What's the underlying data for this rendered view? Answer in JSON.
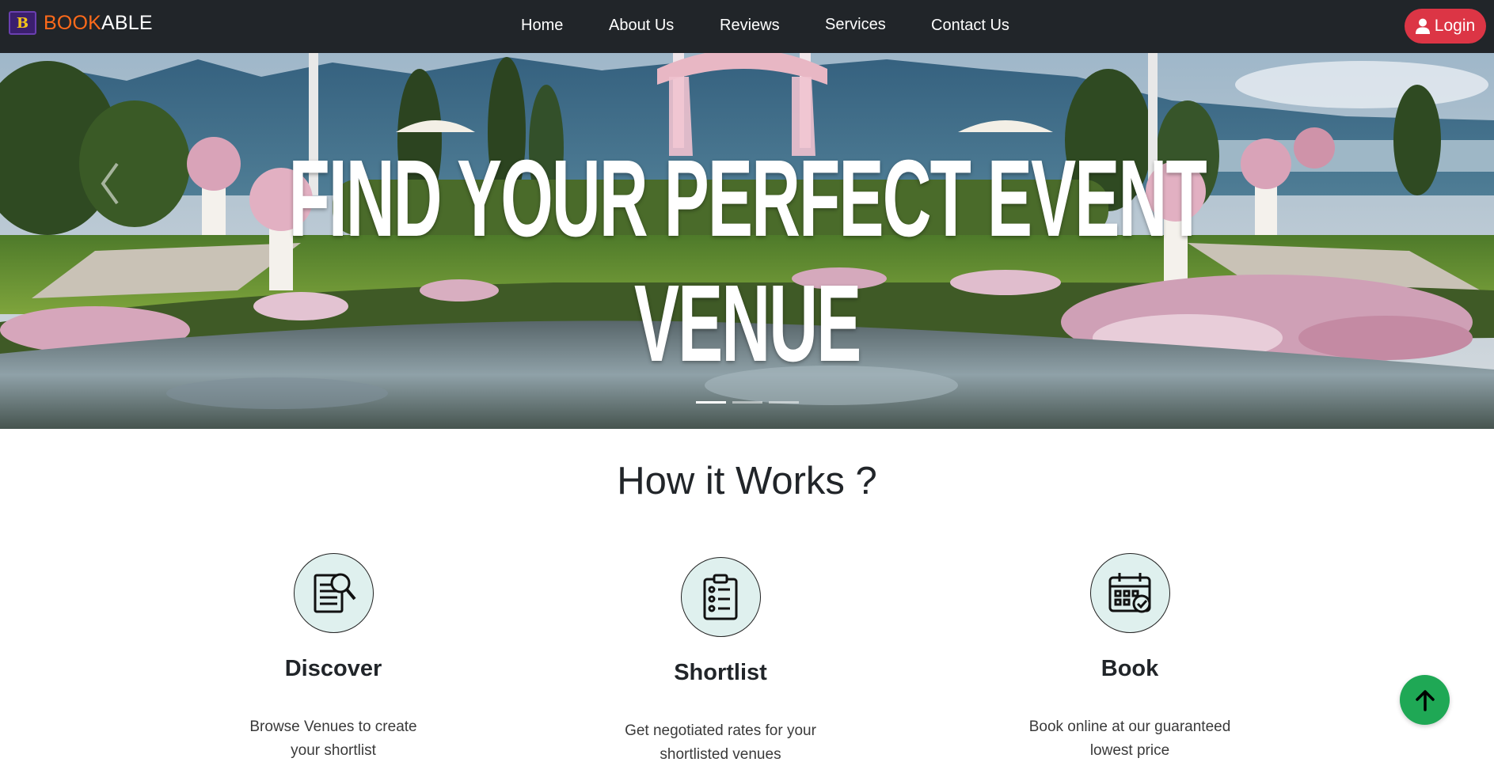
{
  "brand": {
    "book": "BOOK",
    "able": "ABLE",
    "logo_letter": "B"
  },
  "nav": {
    "items": [
      {
        "label": "Home"
      },
      {
        "label": "About Us"
      },
      {
        "label": "Reviews"
      },
      {
        "label": "Services"
      },
      {
        "label": "Contact Us"
      }
    ],
    "login_label": "Login"
  },
  "hero": {
    "title_line1": "FIND YOUR PERFECT EVENT",
    "title_line2": "VENUE",
    "slides": 3,
    "active_slide": 1
  },
  "how_it_works": {
    "title": "How it Works ?",
    "steps": [
      {
        "icon": "document-search-icon",
        "title": "Discover",
        "desc_line1": "Browse Venues to create",
        "desc_line2": "your shortlist"
      },
      {
        "icon": "clipboard-checklist-icon",
        "title": "Shortlist",
        "desc_line1": "Get negotiated rates for your",
        "desc_line2": "shortlisted venues"
      },
      {
        "icon": "calendar-check-icon",
        "title": "Book",
        "desc_line1": "Book online at our guaranteed",
        "desc_line2": "lowest price"
      }
    ]
  },
  "colors": {
    "navbar": "#212529",
    "brand_accent": "#ff6a1a",
    "login_button": "#dc3545",
    "scroll_top_button": "#1fa855",
    "icon_circle": "#dff0ee"
  }
}
